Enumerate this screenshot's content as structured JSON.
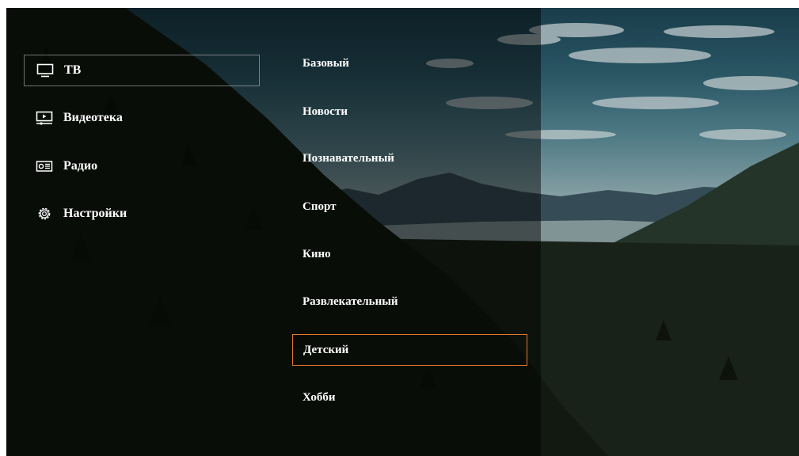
{
  "nav": {
    "items": [
      {
        "label": "ТВ",
        "icon": "tv-icon",
        "active": true
      },
      {
        "label": "Видеотека",
        "icon": "video-library-icon",
        "active": false
      },
      {
        "label": "Радио",
        "icon": "radio-icon",
        "active": false
      },
      {
        "label": "Настройки",
        "icon": "gear-icon",
        "active": false
      }
    ]
  },
  "genres": {
    "items": [
      {
        "label": "Базовый"
      },
      {
        "label": "Новости"
      },
      {
        "label": "Познавательный"
      },
      {
        "label": "Спорт"
      },
      {
        "label": "Кино"
      },
      {
        "label": "Развлекательный"
      },
      {
        "label": "Детский",
        "focused": true
      },
      {
        "label": "Хобби"
      }
    ]
  },
  "colors": {
    "focus_border": "#e07a2e",
    "text": "#ffffff",
    "active_border": "#c8c8c8"
  }
}
